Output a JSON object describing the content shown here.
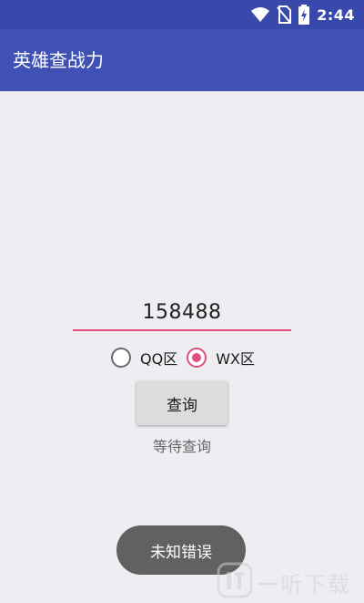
{
  "status_bar": {
    "time": "2:44",
    "icons": [
      "wifi-icon",
      "no-sim-icon",
      "battery-charging-icon"
    ]
  },
  "app_bar": {
    "title": "英雄查战力"
  },
  "search": {
    "input_value": "158488"
  },
  "region_options": [
    {
      "label": "QQ区",
      "checked": false
    },
    {
      "label": "WX区",
      "checked": true
    }
  ],
  "query_button": {
    "label": "查询"
  },
  "status_text": "等待查询",
  "toast": {
    "message": "未知错误"
  },
  "watermark": {
    "text": "一听下载",
    "icon": "watermark-logo-icon"
  },
  "colors": {
    "status_bar": "#3949ab",
    "app_bar": "#3f51b5",
    "accent": "#e0507a",
    "background": "#eeeef2",
    "toast": "#616161"
  }
}
